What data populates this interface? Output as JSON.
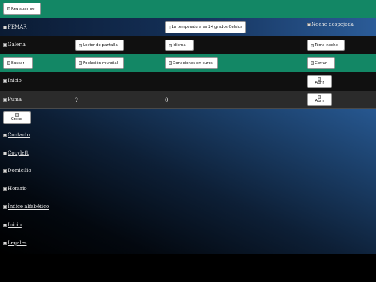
{
  "top_bar": {
    "register_label": "Registrarme"
  },
  "row_femar": {
    "site_label": "FEMAR",
    "temperature_label": "La temperatura es 24 grados Celsius",
    "weather_label": "Noche despejada"
  },
  "row_tools": {
    "gallery_label": "Galería",
    "screen_reader_label": "Lector de pantalla",
    "language_label": "Idioma",
    "night_theme_label": "Tema noche"
  },
  "row_actions": {
    "search_label": "Buscar",
    "population_label": "Población mundial",
    "donations_label": "Donaciones en euros",
    "close_label": "Cerrar"
  },
  "row_home": {
    "home_label": "Inicio",
    "open_label": "Abrir"
  },
  "row_puma": {
    "puma_label": "Puma",
    "col2_value": "?",
    "col3_value": "0",
    "open_label": "Abrir"
  },
  "menu": {
    "close_label": "Cerrar",
    "items": [
      "Contacto",
      "Copyleft",
      "Domicilio",
      "Horario",
      "Índice alfabético",
      "Inicio",
      "Legales"
    ]
  }
}
